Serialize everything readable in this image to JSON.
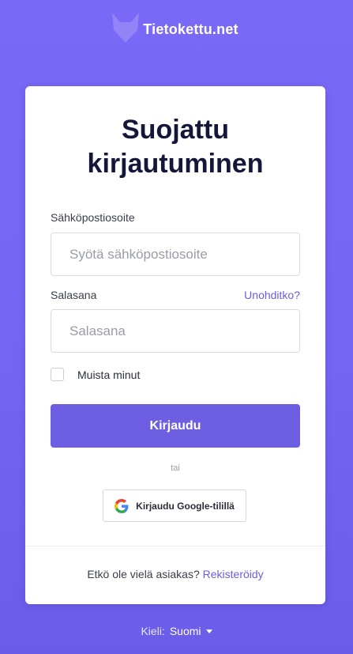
{
  "brand": {
    "name": "Tietokettu.net",
    "logo_icon": "fox-icon"
  },
  "login": {
    "title_line1": "Suojattu",
    "title_line2": "kirjautuminen",
    "email": {
      "label": "Sähköpostiosoite",
      "placeholder": "Syötä sähköpostiosoite",
      "value": ""
    },
    "password": {
      "label": "Salasana",
      "placeholder": "Salasana",
      "value": "",
      "forgot_link": "Unohditko?"
    },
    "remember_me": {
      "label": "Muista minut",
      "checked": false
    },
    "submit_label": "Kirjaudu",
    "separator": "tai",
    "google_button": {
      "label": "Kirjaudu Google-tilillä",
      "icon": "google-icon"
    },
    "signup": {
      "prompt": "Etkö ole vielä asiakas?",
      "link": "Rekisteröidy"
    }
  },
  "language": {
    "label": "Kieli:",
    "selected": "Suomi",
    "icon": "caret-down-icon"
  },
  "colors": {
    "background": "#7568f4",
    "primary_button": "#6e5fe2",
    "link": "#6a5ee0",
    "title_text": "#14173a"
  }
}
